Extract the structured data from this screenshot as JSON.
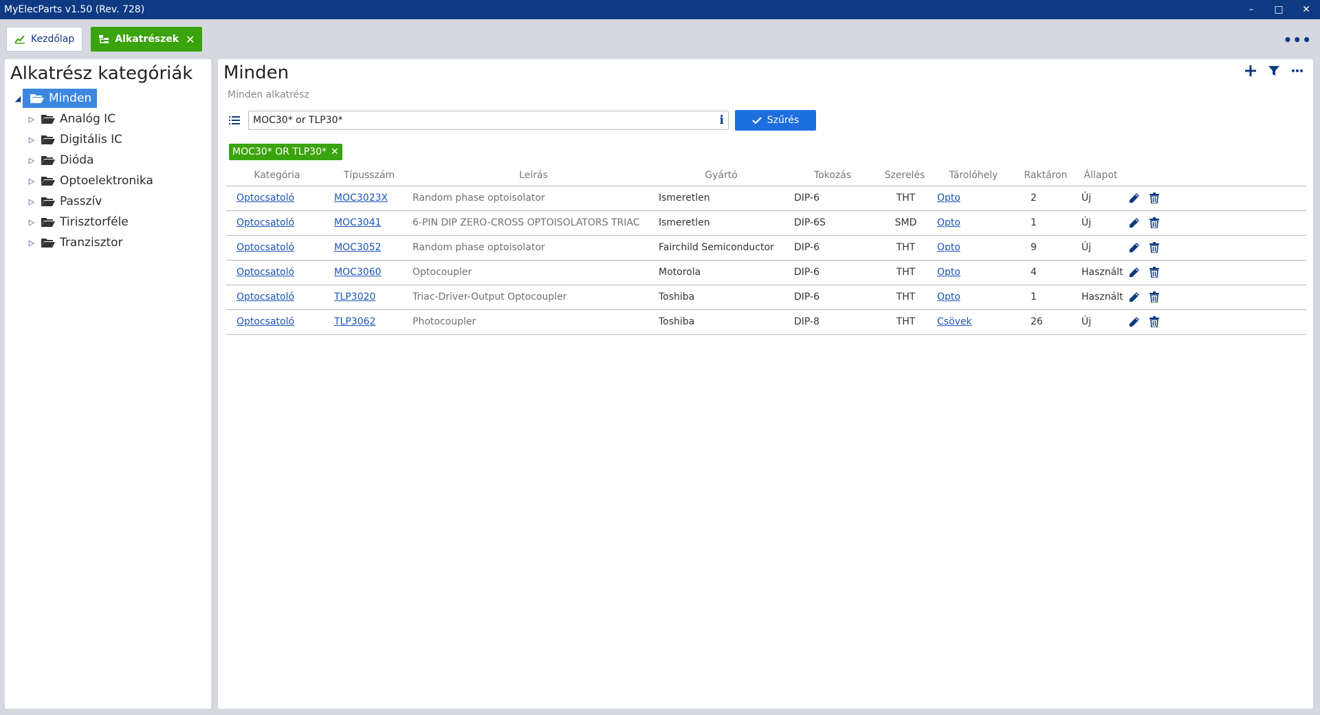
{
  "window": {
    "title": "MyElecParts v1.50  (Rev. 728)"
  },
  "tabs": [
    {
      "label": "Kezdőlap",
      "icon": "chart-line-icon"
    },
    {
      "label": "Alkatrészek",
      "icon": "category-tree-icon"
    }
  ],
  "sidebar": {
    "title": "Alkatrész kategóriák",
    "root": "Minden",
    "items": [
      "Analóg IC",
      "Digitális IC",
      "Dióda",
      "Optoelektronika",
      "Passzív",
      "Tirisztorféle",
      "Tranzisztor"
    ]
  },
  "main": {
    "title": "Minden",
    "subtitle": "Minden alkatrész",
    "search_value": "MOC30* or TLP30*",
    "filter_button": "Szűrés",
    "active_filter": "MOC30* OR TLP30*"
  },
  "table": {
    "headers": [
      "Kategória",
      "Típusszám",
      "Leírás",
      "Gyártó",
      "Tokozás",
      "Szerelés",
      "Tárolóhely",
      "Raktáron",
      "Állapot"
    ],
    "rows": [
      [
        "Optocsatoló",
        "MOC3023X",
        "Random phase optoisolator",
        "Ismeretlen",
        "DIP-6",
        "THT",
        "Opto",
        "2",
        "Új"
      ],
      [
        "Optocsatoló",
        "MOC3041",
        "6-PIN DIP ZERO-CROSS OPTOISOLATORS TRIAC",
        "Ismeretlen",
        "DIP-6S",
        "SMD",
        "Opto",
        "1",
        "Új"
      ],
      [
        "Optocsatoló",
        "MOC3052",
        "Random phase optoisolator",
        "Fairchild Semiconductor",
        "DIP-6",
        "THT",
        "Opto",
        "9",
        "Új"
      ],
      [
        "Optocsatoló",
        "MOC3060",
        "Optocoupler",
        "Motorola",
        "DIP-6",
        "THT",
        "Opto",
        "4",
        "Használt"
      ],
      [
        "Optocsatoló",
        "TLP3020",
        "Triac-Driver-Output Optocoupler",
        "Toshiba",
        "DIP-6",
        "THT",
        "Opto",
        "1",
        "Használt"
      ],
      [
        "Optocsatoló",
        "TLP3062",
        "Photocoupler",
        "Toshiba",
        "DIP-8",
        "THT",
        "Csövek",
        "26",
        "Új"
      ]
    ]
  },
  "colors": {
    "titlebar": "#0e3a82",
    "accent_green": "#3aa30e",
    "selection_blue": "#3d87e0",
    "button_blue": "#1d6fe0",
    "link": "#1a54b8"
  }
}
